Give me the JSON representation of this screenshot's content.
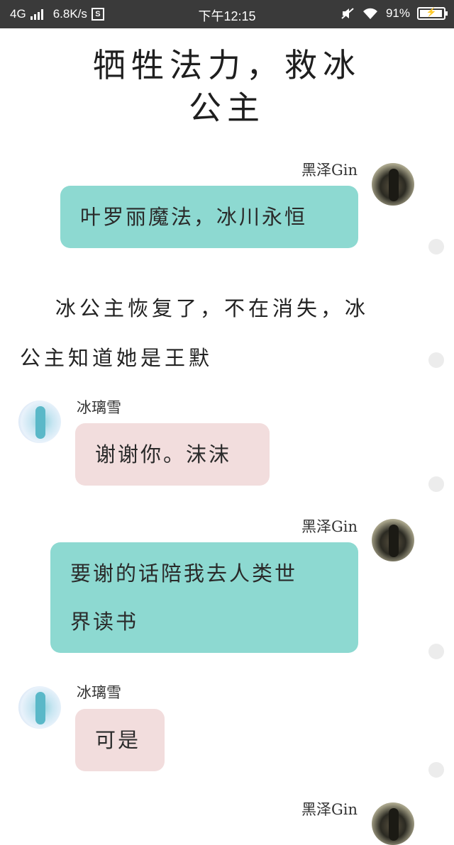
{
  "status_bar": {
    "network": "4G",
    "speed": "6.8K/s",
    "s_badge": "S",
    "time": "下午12:15",
    "battery": "91%",
    "icons": [
      "signal-icon",
      "mute-icon",
      "wifi-icon",
      "battery-icon"
    ]
  },
  "title": {
    "line1": "牺牲法力，救冰",
    "line2": "公主"
  },
  "messages": [
    {
      "sender": "黑泽Gin",
      "side": "right",
      "text": "叶罗丽魔法，冰川永恒"
    },
    {
      "sender": "冰璃雪",
      "side": "left",
      "text": "谢谢你。沫沫"
    },
    {
      "sender": "黑泽Gin",
      "side": "right",
      "lines": [
        "要谢的话陪我去人类世",
        "界读书"
      ]
    },
    {
      "sender": "冰璃雪",
      "side": "left",
      "text": "可是"
    },
    {
      "sender": "黑泽Gin",
      "side": "right"
    }
  ],
  "narration": {
    "line1": "冰公主恢复了，不在消失，冰",
    "line2": "公主知道她是王默"
  },
  "colors": {
    "status_bar_bg": "#3a3a3a",
    "right_bubble": "#8dd9d1",
    "left_bubble": "#f2dddd"
  }
}
